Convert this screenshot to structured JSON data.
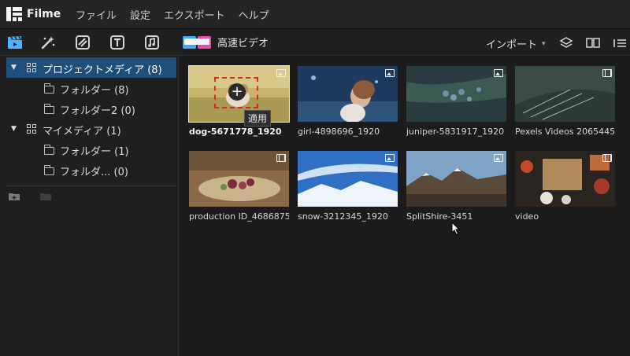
{
  "app": {
    "name": "Filme"
  },
  "menu": {
    "items": [
      "ファイル",
      "設定",
      "エクスポート",
      "ヘルプ"
    ]
  },
  "toolbar": {
    "tools": [
      {
        "name": "media-tab",
        "icon": "clapper-icon",
        "active": true
      },
      {
        "name": "effects-tab",
        "icon": "sparkle-wand-icon"
      },
      {
        "name": "transitions-tab",
        "icon": "transition-icon"
      },
      {
        "name": "text-tab",
        "icon": "text-t-icon"
      },
      {
        "name": "music-tab",
        "icon": "music-note-icon"
      }
    ],
    "speed_video_label": "高速ビデオ",
    "import_label": "インポート",
    "accent": "#4db3ff"
  },
  "sidebar": {
    "tree": [
      {
        "label": "プロジェクトメディア (8)",
        "kind": "root",
        "selected": true,
        "expanded": true
      },
      {
        "label": "フォルダー (8)",
        "kind": "folder"
      },
      {
        "label": "フォルダー2 (0)",
        "kind": "folder"
      },
      {
        "label": "マイメディア (1)",
        "kind": "root",
        "expanded": true
      },
      {
        "label": "フォルダー (1)",
        "kind": "folder"
      },
      {
        "label": "フォルダ... (0)",
        "kind": "folder"
      }
    ],
    "selected_color": "#1f4e79"
  },
  "media": {
    "items": [
      {
        "name": "dog-5671778_1920",
        "type": "image",
        "selected": true
      },
      {
        "name": "girl-4898696_1920",
        "type": "image"
      },
      {
        "name": "juniper-5831917_1920",
        "type": "image"
      },
      {
        "name": "Pexels Videos 2065445",
        "type": "video"
      },
      {
        "name": "production ID_4686875",
        "type": "video"
      },
      {
        "name": "snow-3212345_1920",
        "type": "image"
      },
      {
        "name": "SplitShire-3451",
        "type": "image"
      },
      {
        "name": "video",
        "type": "video"
      }
    ],
    "apply_tooltip": "適用",
    "apply_plus": "+"
  }
}
